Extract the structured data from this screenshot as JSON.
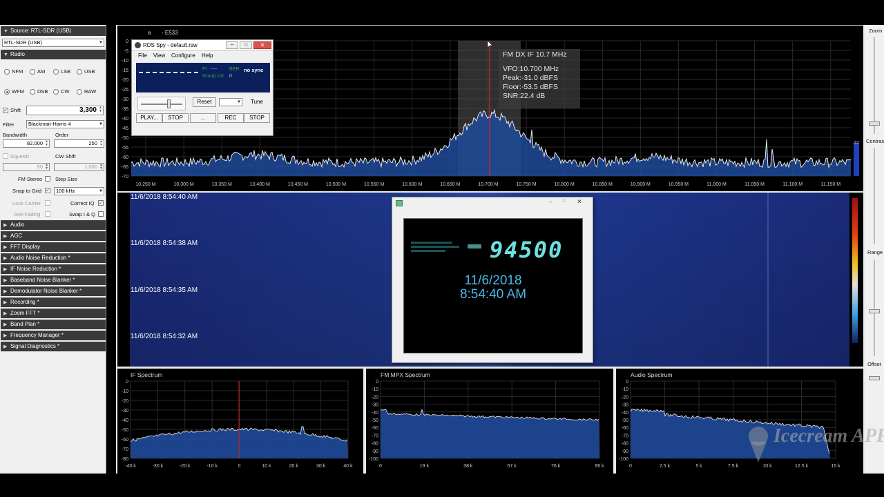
{
  "left_panel": {
    "source_header": "Source: RTL-SDR (USB)",
    "source_select": "RTL-SDR (USB)",
    "radio_header": "Radio",
    "modes": [
      {
        "label": "NFM",
        "selected": false
      },
      {
        "label": "AM",
        "selected": false
      },
      {
        "label": "LSB",
        "selected": false
      },
      {
        "label": "USB",
        "selected": false
      },
      {
        "label": "WFM",
        "selected": true
      },
      {
        "label": "DSB",
        "selected": false
      },
      {
        "label": "CW",
        "selected": false
      },
      {
        "label": "RAW",
        "selected": false
      }
    ],
    "shift_label": "Shift",
    "shift_value": "3,300",
    "filter_label": "Filter",
    "filter_value": "Blackman-Harris 4",
    "bandwidth_label": "Bandwidth",
    "bandwidth_value": "82.000",
    "order_label": "Order",
    "order_value": "250",
    "squelch_label": "Squelch",
    "squelch_value": "50",
    "cw_shift_label": "CW Shift",
    "cw_shift_value": "1,000",
    "fm_stereo_label": "FM Stereo",
    "step_size_label": "Step Size",
    "snap_to_grid_label": "Snap to Grid",
    "step_value": "100 kHz",
    "lock_carrier_label": "Lock Carrier",
    "correct_iq_label": "Correct IQ",
    "anti_fading_label": "Anti-Fading",
    "swap_iq_label": "Swap I & Q",
    "sections": [
      "Audio",
      "AGC",
      "FFT Display",
      "Audio Noise Reduction *",
      "IF Noise Reduction *",
      "Baseband Noise Blanker *",
      "Demodulator Noise Blanker *",
      "Recording *",
      "Zoom FFT *",
      "Band Plan *",
      "Frequency Manager *",
      "Signal Diagnostics *"
    ]
  },
  "spectrum": {
    "top_label_a": "a",
    "top_label_b": "- E533",
    "y_ticks": [
      "0",
      "-5",
      "-10",
      "-15",
      "-20",
      "-25",
      "-30",
      "-35",
      "-40",
      "-45",
      "-50",
      "-55",
      "-60",
      "-65",
      "-70"
    ],
    "x_ticks": [
      "10.250 M",
      "10.300 M",
      "10.350 M",
      "10.400 M",
      "10.450 M",
      "10.500 M",
      "10.550 M",
      "10.600 M",
      "10.650 M",
      "10.700 M",
      "10.750 M",
      "10.800 M",
      "10.850 M",
      "10.900 M",
      "10.950 M",
      "11.000 M",
      "11.050 M",
      "11.100 M",
      "11.150 M"
    ],
    "tooltip": {
      "title": "FM DX IF 10.7 MHz",
      "vfo": "VFO:10.700 MHz",
      "peak": "Peak:-31.0 dBFS",
      "floor": "Floor:-53.5 dBFS",
      "snr": "SNR:22.4 dB"
    },
    "contrast_value": "22"
  },
  "waterfall": {
    "timestamps": [
      "11/6/2018 8:54:40 AM",
      "11/6/2018 8:54:38 AM",
      "11/6/2018 8:54:35 AM",
      "11/6/2018 8:54:32 AM"
    ]
  },
  "right_bar": {
    "zoom_label": "Zoom",
    "contrast_label": "Contrast",
    "range_label": "Range",
    "offset_label": "Offset"
  },
  "rds_window": {
    "title": "RDS Spy - default.rsw",
    "menu": [
      "File",
      "View",
      "Configure",
      "Help"
    ],
    "pi_label": "PI",
    "pi_value": "----",
    "ber_label": "BER",
    "sync_status": "no sync",
    "group_cnt_label": "Group cnt",
    "group_cnt_value": "0",
    "reset_label": "Reset",
    "tune_label": "Tune",
    "play_label": "PLAY...",
    "stop_label": "STOP",
    "dots_label": "...",
    "rec_label": "REC",
    "stop2_label": "STOP"
  },
  "clock_window": {
    "frequency": "94500",
    "date": "11/6/2018",
    "time": "8:54:40 AM"
  },
  "if_spectrum": {
    "title": "IF Spectrum",
    "y_ticks": [
      "0",
      "-10",
      "-20",
      "-30",
      "-40",
      "-50",
      "-60",
      "-70",
      "-80"
    ],
    "x_ticks": [
      "-40 k",
      "-30 k",
      "-20 k",
      "-10 k",
      "0",
      "10 k",
      "20 k",
      "30 k",
      "40 k"
    ]
  },
  "mpx_spectrum": {
    "title": "FM MPX Spectrum",
    "y_ticks": [
      "0",
      "-10",
      "-20",
      "-30",
      "-40",
      "-50",
      "-60",
      "-70",
      "-80",
      "-90",
      "-100"
    ],
    "x_ticks": [
      "0",
      "19 k",
      "38 k",
      "57 k",
      "76 k",
      "95 k"
    ]
  },
  "audio_spectrum": {
    "title": "Audio Spectrum",
    "y_ticks": [
      "0",
      "-10",
      "-20",
      "-30",
      "-40",
      "-50",
      "-60",
      "-70",
      "-80",
      "-90",
      "-100"
    ],
    "x_ticks": [
      "0",
      "2.5 k",
      "5 k",
      "7.5 k",
      "10 k",
      "12.5 k",
      "15 k"
    ]
  },
  "watermark": "Icecream APPS",
  "colors": {
    "header_bg": "#3a3a3a",
    "spectrum_fill": "#1f4a9a",
    "waterfall_bg": "#1a2f7a",
    "vfo_line": "#e02020"
  }
}
